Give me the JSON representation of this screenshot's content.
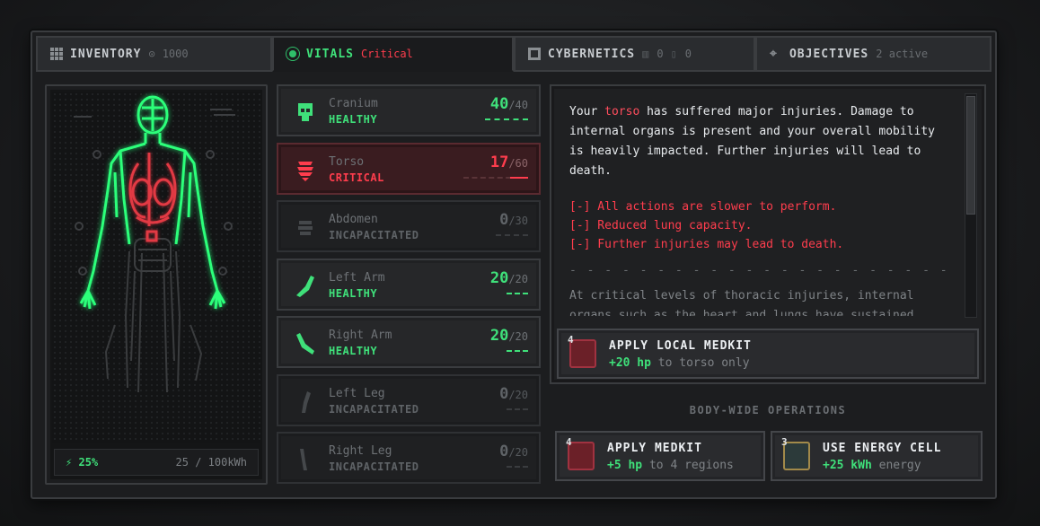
{
  "tabs": [
    {
      "label": "INVENTORY",
      "sub": "1000",
      "icon": "grid-icon"
    },
    {
      "label": "VITALS",
      "sub": "Critical",
      "icon": "vitals-icon"
    },
    {
      "label": "CYBERNETICS",
      "sub1": "0",
      "sub2": "0",
      "icon": "chip-icon"
    },
    {
      "label": "OBJECTIVES",
      "sub": "2 active",
      "icon": "target-icon"
    }
  ],
  "power": {
    "percent": "25%",
    "capacity": "25 / 100kWh"
  },
  "regions": [
    {
      "name": "Cranium",
      "status": "HEALTHY",
      "hp": "40",
      "max": "/40",
      "level": "healthy"
    },
    {
      "name": "Torso",
      "status": "CRITICAL",
      "hp": "17",
      "max": "/60",
      "level": "critical"
    },
    {
      "name": "Abdomen",
      "status": "INCAPACITATED",
      "hp": "0",
      "max": "/30",
      "level": "incap"
    },
    {
      "name": "Left Arm",
      "status": "HEALTHY",
      "hp": "20",
      "max": "/20",
      "level": "healthy"
    },
    {
      "name": "Right Arm",
      "status": "HEALTHY",
      "hp": "20",
      "max": "/20",
      "level": "healthy"
    },
    {
      "name": "Left Leg",
      "status": "INCAPACITATED",
      "hp": "0",
      "max": "/20",
      "level": "incap"
    },
    {
      "name": "Right Leg",
      "status": "INCAPACITATED",
      "hp": "0",
      "max": "/20",
      "level": "incap"
    }
  ],
  "description": {
    "intro_a": "Your ",
    "intro_hl": "torso",
    "intro_b": " has suffered major injuries. Damage to internal organs is present and your overall mobility is heavily impacted. Further injuries will lead to death.",
    "effects": [
      "[-] All actions are slower to perform.",
      "[-] Reduced lung capacity.",
      "[-] Further injuries may lead to death."
    ],
    "separator": "- - - - - - - - - - - - - - - - - - - - - - - - - - - - - -",
    "lore": "At critical levels of thoracic injuries, internal organs such as the heart and lungs have sustained severe damage."
  },
  "local_action": {
    "count": "4",
    "title": "APPLY LOCAL MEDKIT",
    "amount": "+20 hp",
    "rest": " to torso only"
  },
  "body_wide_label": "BODY-WIDE OPERATIONS",
  "actions": [
    {
      "count": "4",
      "title": "APPLY MEDKIT",
      "amount": "+5 hp",
      "rest": " to 4 regions"
    },
    {
      "count": "3",
      "title": "USE ENERGY CELL",
      "amount": "+25 kWh",
      "rest": " energy"
    }
  ],
  "colors": {
    "healthy": "#3fe07a",
    "critical": "#ff3d4d",
    "incapacitated": "#5f6367"
  }
}
